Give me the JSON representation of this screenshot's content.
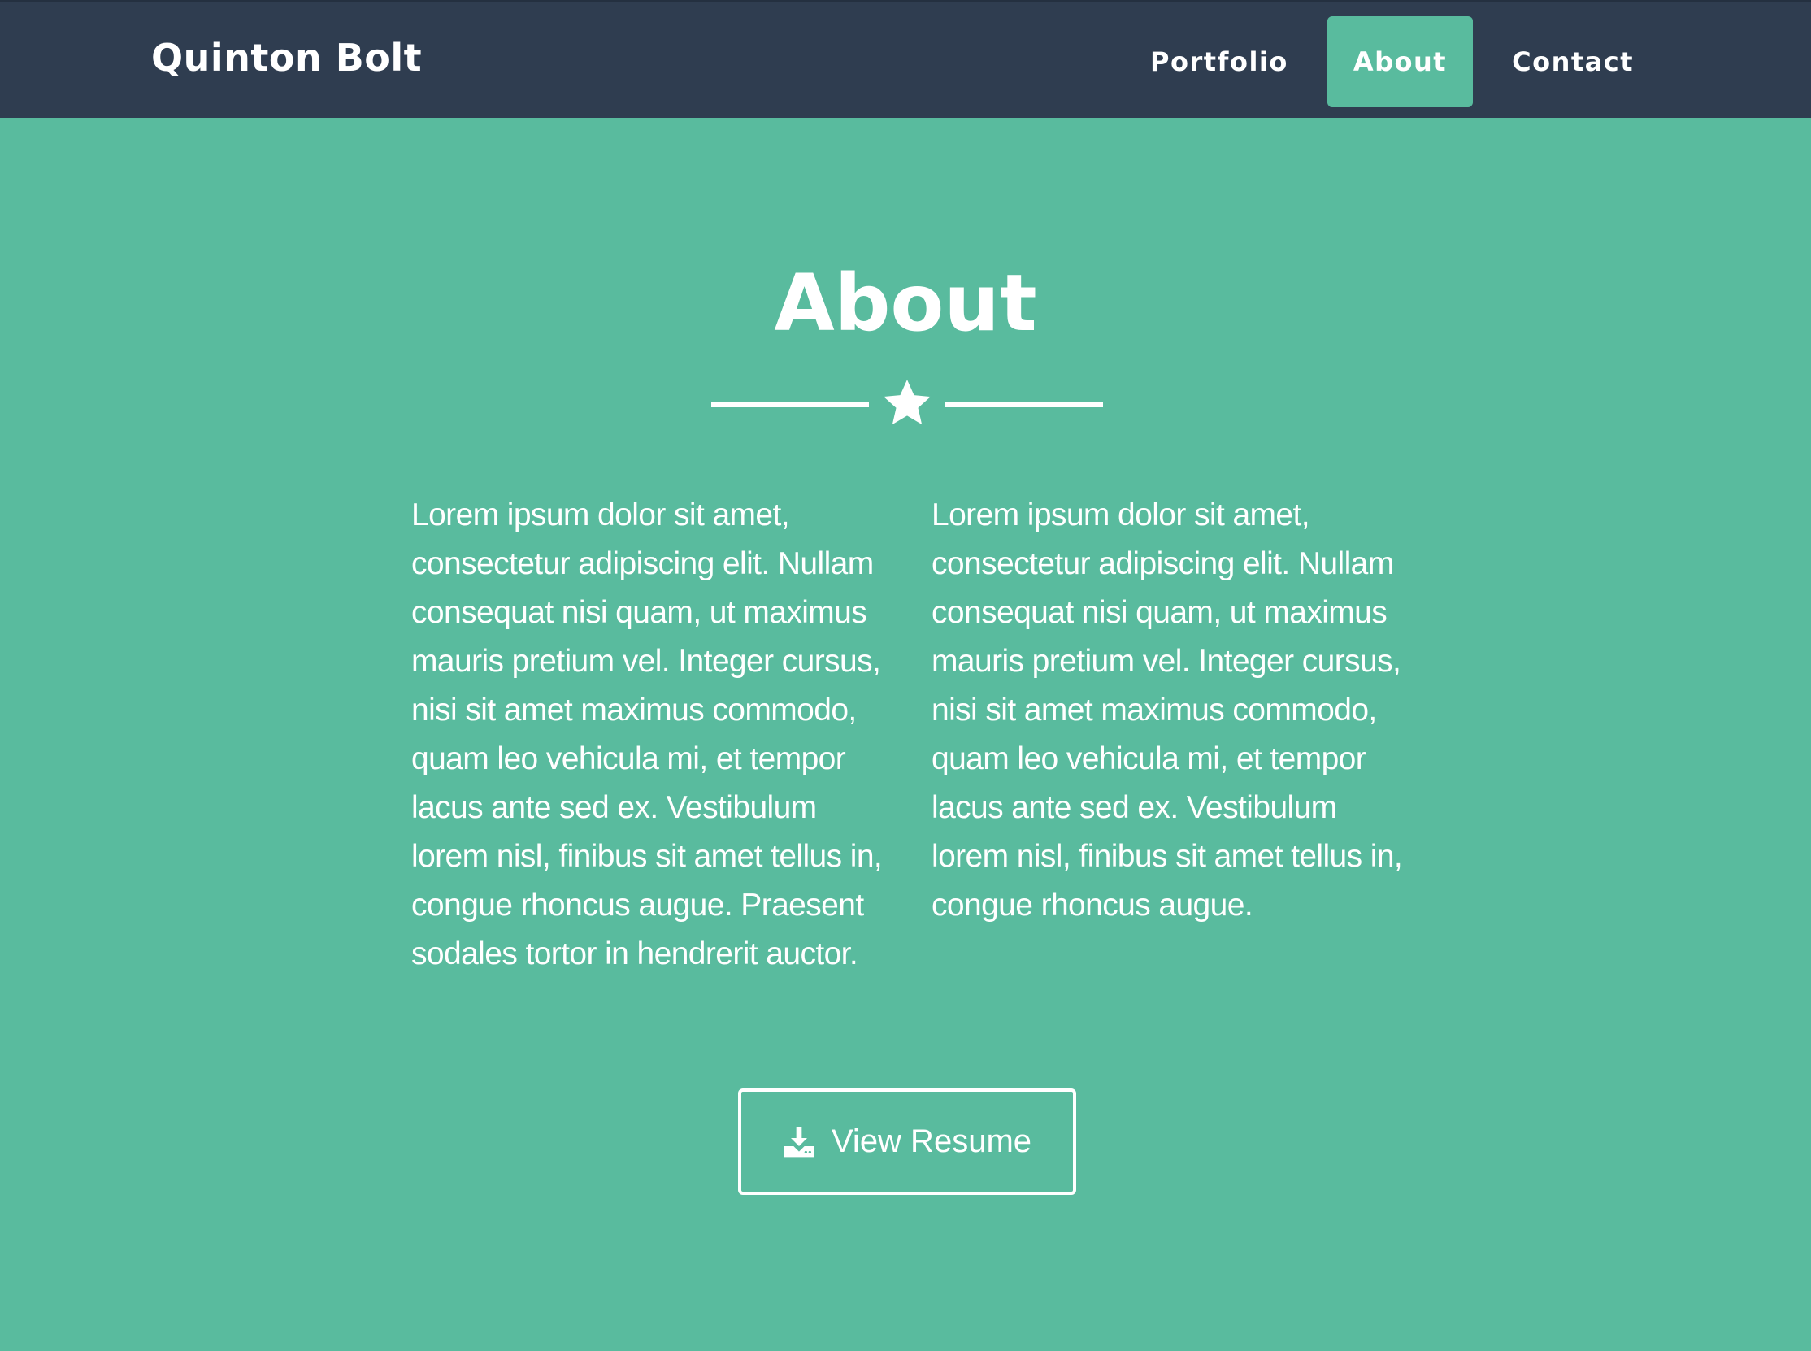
{
  "navbar": {
    "brand": "Quinton Bolt",
    "links": [
      {
        "label": "Portfolio",
        "active": false
      },
      {
        "label": "About",
        "active": true
      },
      {
        "label": "Contact",
        "active": false
      }
    ]
  },
  "about": {
    "title": "About",
    "divider_icon": "star-icon",
    "column_left": "Lorem ipsum dolor sit amet, consectetur adipiscing elit. Nullam consequat nisi quam, ut maximus mauris pretium vel. Integer cursus, nisi sit amet maximus commodo, quam leo vehicula mi, et tempor lacus ante sed ex. Vestibulum lorem nisl, finibus sit amet tellus in, congue rhoncus augue. Praesent sodales tortor in hendrerit auctor.",
    "column_right": "Lorem ipsum dolor sit amet, consectetur adipiscing elit. Nullam consequat nisi quam, ut maximus mauris pretium vel. Integer cursus, nisi sit amet maximus commodo, quam leo vehicula mi, et tempor lacus ante sed ex. Vestibulum lorem nisl, finibus sit amet tellus in, congue rhoncus augue.",
    "resume_button": {
      "label": "View Resume",
      "icon": "download-icon"
    }
  },
  "colors": {
    "navbar_bg": "#2f3d50",
    "accent": "#59bb9e",
    "text": "#ffffff"
  }
}
